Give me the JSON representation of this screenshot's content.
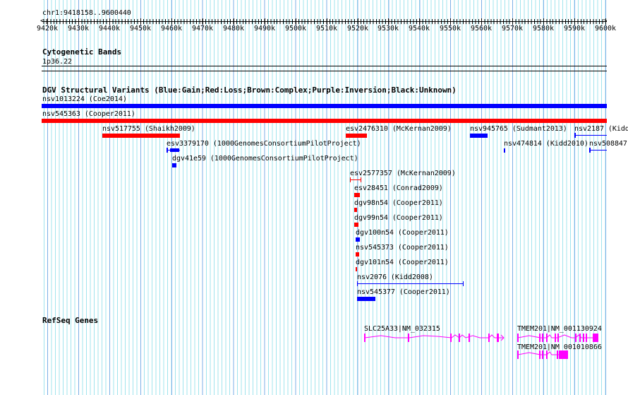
{
  "ruler": {
    "location": "chr1:9418158..9600440",
    "ticks": [
      "9420k",
      "9430k",
      "9440k",
      "9450k",
      "9460k",
      "9470k",
      "9480k",
      "9490k",
      "9500k",
      "9510k",
      "9520k",
      "9530k",
      "9540k",
      "9550k",
      "9560k",
      "9570k",
      "9580k",
      "9590k",
      "9600k"
    ]
  },
  "cytobands": {
    "title": "Cytogenetic Bands",
    "band": "1p36.22"
  },
  "dgv": {
    "title": "DGV Structural Variants (Blue:Gain;Red:Loss;Brown:Complex;Purple:Inversion;Black:Unknown)",
    "colors": {
      "gain": "#0000ff",
      "loss": "#ff0000"
    },
    "features": [
      {
        "label": "nsv1013224 (Coe2014)",
        "type": "gain"
      },
      {
        "label": "nsv545363 (Cooper2011)",
        "type": "loss"
      },
      {
        "label": "nsv517755 (Shaikh2009)",
        "type": "loss"
      },
      {
        "label": "esv2476310 (McKernan2009)",
        "type": "loss"
      },
      {
        "label": "nsv945765 (Sudmant2013)",
        "type": "gain"
      },
      {
        "label": "nsv2187 (Kidd",
        "type": "gain"
      },
      {
        "label": "esv3379170 (1000GenomesConsortiumPilotProject)",
        "type": "gain"
      },
      {
        "label": "nsv474814 (Kidd2010)",
        "type": "gain"
      },
      {
        "label": "nsv508847",
        "type": "gain"
      },
      {
        "label": "dgv41e59 (1000GenomesConsortiumPilotProject)",
        "type": "gain"
      },
      {
        "label": "esv2577357 (McKernan2009)",
        "type": "loss"
      },
      {
        "label": "esv28451 (Conrad2009)",
        "type": "loss"
      },
      {
        "label": "dgv98n54 (Cooper2011)",
        "type": "loss"
      },
      {
        "label": "dgv99n54 (Cooper2011)",
        "type": "loss"
      },
      {
        "label": "dgv100n54 (Cooper2011)",
        "type": "gain"
      },
      {
        "label": "nsv545373 (Cooper2011)",
        "type": "loss"
      },
      {
        "label": "dgv101n54 (Cooper2011)",
        "type": "loss"
      },
      {
        "label": "nsv2076 (Kidd2008)",
        "type": "gain"
      },
      {
        "label": "nsv545377 (Cooper2011)",
        "type": "gain"
      }
    ]
  },
  "refseq": {
    "title": "RefSeq Genes",
    "color": "#ff00ff",
    "genes": [
      {
        "label": "SLC25A33|NM_032315"
      },
      {
        "label": "TMEM201|NM_001130924"
      },
      {
        "label": "TMEM201|NM_001010866"
      }
    ]
  }
}
